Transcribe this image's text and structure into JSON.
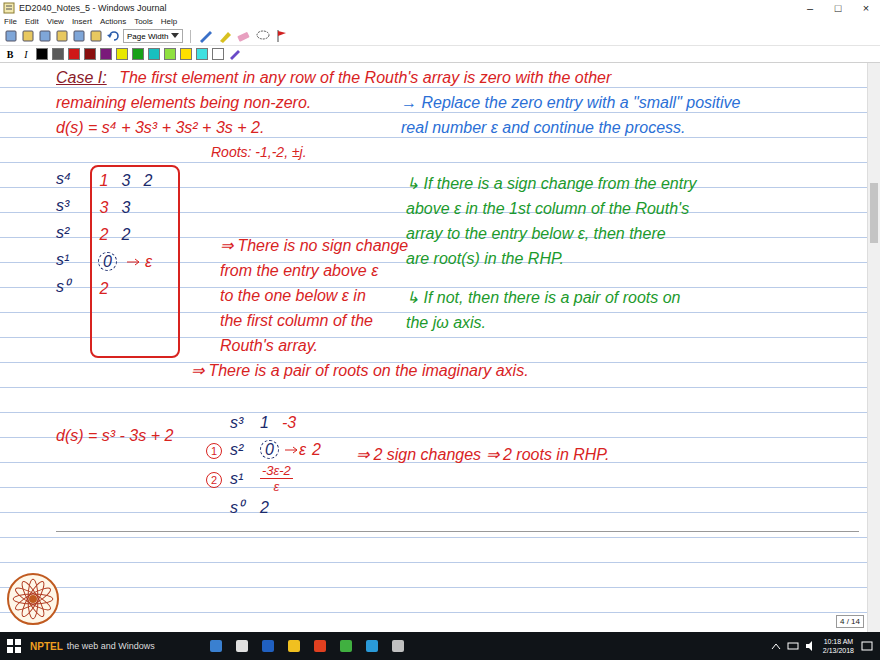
{
  "window": {
    "title": "ED2040_Notes_5 - Windows Journal",
    "controls": [
      "–",
      "□",
      "×"
    ]
  },
  "menu": [
    "File",
    "Edit",
    "View",
    "Insert",
    "Actions",
    "Tools",
    "Help"
  ],
  "toolbar": {
    "zoom": "Page Width"
  },
  "format_bar": {
    "bold": "B",
    "italic": "I",
    "pen_colors": [
      {
        "color": "#000000"
      },
      {
        "color": "#5a5a5a"
      },
      {
        "color": "#d01818"
      },
      {
        "color": "#8a1010"
      },
      {
        "color": "#7a1a7a"
      },
      {
        "color": "#e8e800"
      },
      {
        "color": "#18a018"
      },
      {
        "color": "#18c0c0"
      },
      {
        "color": "#90e040"
      },
      {
        "color": "#ffe000"
      },
      {
        "color": "#40e0e0"
      },
      {
        "color": "#ffffff"
      }
    ]
  },
  "page": {
    "heading": {
      "label": "Case I:",
      "label_color": "#8a1a2a",
      "text": "The first element in any row of the Routh's array is zero with the other",
      "color": "#d8231f"
    },
    "heading_cont": {
      "text": "remaining elements being non-zero.",
      "color": "#d8231f"
    },
    "rule": {
      "lines": [
        "→ Replace the zero entry with a \"small\" positive",
        "real number ε and continue the process."
      ],
      "color": "#2b6fd6"
    },
    "example1": {
      "polynomial": "d(s) = s⁴ + 3s³ + 3s² + 3s + 2.",
      "roots": "Roots: -1,-2, ±j.",
      "color": "#d8231f",
      "routh": [
        {
          "power": "s⁴",
          "kind": "plain",
          "entries": [
            "1",
            "3",
            "2"
          ],
          "step": ""
        },
        {
          "power": "s³",
          "kind": "plain",
          "entries": [
            "3",
            "3"
          ],
          "step": ""
        },
        {
          "power": "s²",
          "kind": "plain",
          "entries": [
            "2",
            "2"
          ],
          "step": ""
        },
        {
          "power": "s¹",
          "kind": "zero",
          "entries": [
            "0"
          ],
          "replacement": "ε",
          "step": ""
        },
        {
          "power": "s⁰",
          "kind": "plain",
          "entries": [
            "2"
          ],
          "step": ""
        }
      ],
      "observation": [
        "⇒ There is no sign change",
        "from the entry above ε",
        "to the one below ε in",
        "the first column of the",
        "Routh's array."
      ],
      "conclusion": "⇒ There is a pair of roots on the imaginary axis."
    },
    "cases": {
      "color": "#1c9a2c",
      "items": [
        {
          "lines": [
            "↳ If there is a sign change from the entry",
            "above ε in the 1st column of the Routh's",
            "array to the entry below ε, then there",
            "are root(s) in the RHP."
          ]
        },
        {
          "lines": [
            "↳ If not, then there is a pair of roots on",
            "the jω axis."
          ]
        }
      ]
    },
    "example2": {
      "polynomial": "d(s) = s³ - 3s + 2",
      "color": "#d8231f",
      "routh": [
        {
          "power": "s³",
          "kind": "plain",
          "entries": [
            "1",
            "-3"
          ],
          "step": ""
        },
        {
          "power": "s²",
          "kind": "zero",
          "entries": [
            "0",
            "2"
          ],
          "replacement": "ε",
          "step": "1"
        },
        {
          "power": "s¹",
          "kind": "fraction",
          "numerator": "-3ε-2",
          "denominator": "ε",
          "step": "2"
        },
        {
          "power": "s⁰",
          "kind": "plain",
          "entries": [
            "2"
          ],
          "step": ""
        }
      ],
      "result": "⇒ 2 sign changes ⇒ 2 roots in RHP."
    }
  },
  "page_indicator": "4 / 14",
  "logo": "NPTEL",
  "taskbar": {
    "search": "the web and Windows",
    "time": "10:18 AM",
    "date": "2/13/2018"
  }
}
